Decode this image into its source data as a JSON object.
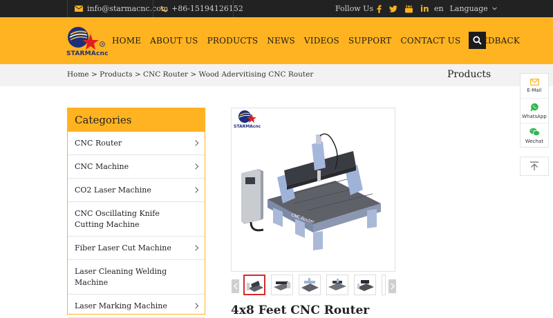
{
  "topbar": {
    "email": "info@starmacnc.com",
    "phone": "+86-15194126152",
    "follow_label": "Follow Us",
    "lang_code": "en",
    "language_label": "Language"
  },
  "header": {
    "logo_text": "STARMAcnc",
    "nav": [
      "HOME",
      "ABOUT US",
      "PRODUCTS",
      "NEWS",
      "VIDEOS",
      "SUPPORT",
      "CONTACT US",
      "FEEDBACK"
    ]
  },
  "breadcrumb": {
    "items": [
      "Home",
      "Products",
      "CNC Router",
      "Wood Adervitising CNC Router"
    ],
    "title": "Products"
  },
  "categories": {
    "heading": "Categories",
    "items": [
      "CNC Router",
      "CNC Machine",
      "CO2 Laser Machine",
      "CNC Oscillating Knife Cutting Machine",
      "Fiber Laser Cut Machine",
      "Laser Cleaning Welding Machine",
      "Laser Marking Machine"
    ]
  },
  "product": {
    "image_logo_text": "STARMAcnc",
    "machine_label": "CNC Router",
    "title_partial": "4x8 Feet CNC Router"
  },
  "float": {
    "email_label": "E-Mail",
    "whatsapp_label": "WhatsApp",
    "wechat_label": "Wechat"
  },
  "colors": {
    "accent": "#ffb320",
    "topbar": "#222222",
    "active_thumb": "#d42a2a"
  }
}
